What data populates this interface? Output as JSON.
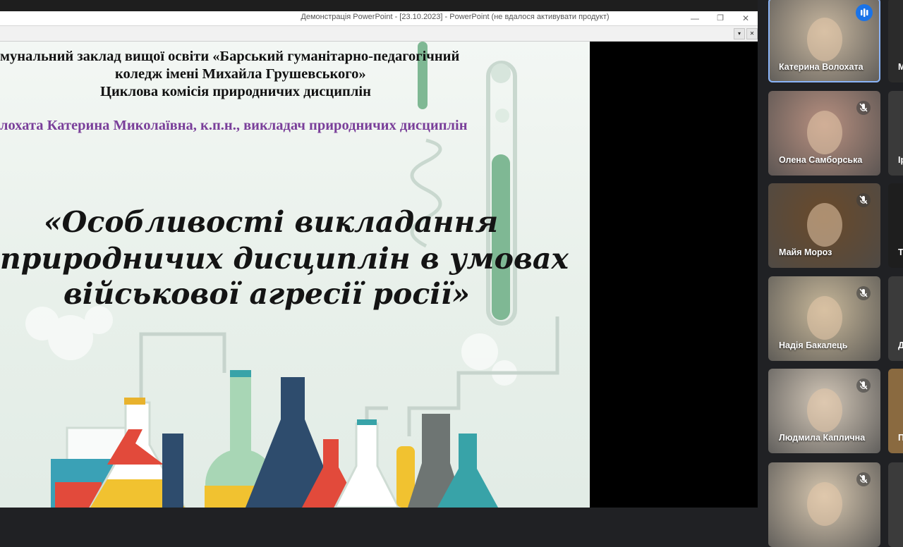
{
  "window": {
    "title": "Демонстрація PowerPoint - [23.10.2023] - PowerPoint (не вдалося активувати продукт)",
    "minimize": "—",
    "restore": "❐",
    "close": "✕",
    "sub_dropdown": "▾",
    "sub_close": "✕"
  },
  "slide": {
    "header_lines": [
      "мунальний заклад вищої освіти «Барський гуманітарно-педагогічний",
      "коледж імені Михайла Грушевського»",
      "Циклова комісія природничих дисциплін"
    ],
    "author": "лохата Катерина Миколаївна, к.п.н., викладач природничих дисциплін",
    "title_lines": [
      "«Особливості викладання",
      "природничих дисциплін в умовах",
      "військової агресії росії»"
    ],
    "colors": {
      "author": "#7a3f9a",
      "background": "#eaf2ec"
    }
  },
  "participants": [
    {
      "name": "Катерина Волохата",
      "state": "speaking",
      "icon": "speaking-icon",
      "bg": "#c9b8a0"
    },
    {
      "name": "Олена Самборська",
      "state": "muted",
      "icon": "mic-off-icon",
      "bg": "#b89080"
    },
    {
      "name": "Майя Мороз",
      "state": "muted",
      "icon": "mic-off-icon",
      "bg": "#6a4a2a"
    },
    {
      "name": "Надія Бакалець",
      "state": "muted",
      "icon": "mic-off-icon",
      "bg": "#c8b89a"
    },
    {
      "name": "Людмила Каплична",
      "state": "muted",
      "icon": "mic-off-icon",
      "bg": "#d4c8b8"
    },
    {
      "name": "",
      "state": "muted",
      "icon": "mic-off-icon",
      "bg": "#d8c8b0"
    }
  ],
  "participants_col2": [
    {
      "name": "М",
      "bg": "#2b2b2b"
    },
    {
      "name": "Ір",
      "bg": "#3a3a3a"
    },
    {
      "name": "Т",
      "bg": "#1e1e1e"
    },
    {
      "name": "Д",
      "bg": "#3b3b3b"
    },
    {
      "name": "П",
      "bg": "#8a6a40"
    },
    {
      "name": "",
      "bg": "#3b3b3b"
    }
  ]
}
